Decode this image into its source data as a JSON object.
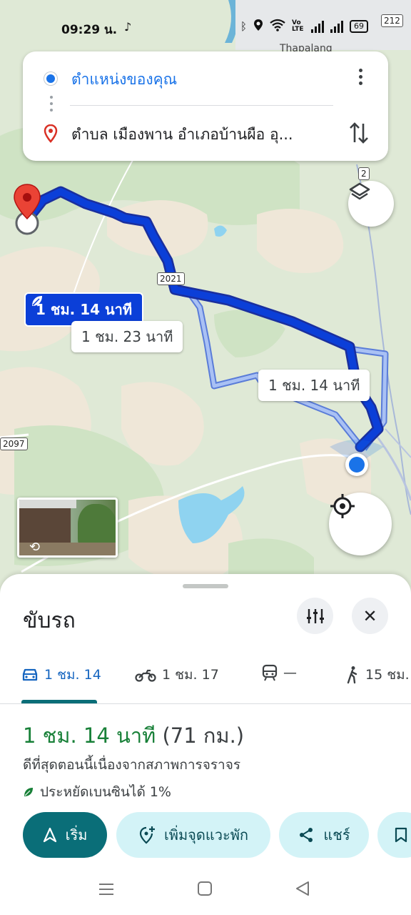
{
  "status_bar": {
    "time": "09:29 น.",
    "battery": "69",
    "volte": "Vo LTE",
    "shield_top": "212"
  },
  "search": {
    "origin": "ตำแหน่งของคุณ",
    "destination": "ตำบล เมืองพาน อำเภอบ้านผือ อุ..."
  },
  "map": {
    "place_label": "Thapalang",
    "road_2021": "2021",
    "road_2": "2",
    "road_2097": "2097",
    "route_main": "1 ชม. 14 นาที",
    "route_alt_1": "1 ชม. 23 นาที",
    "route_alt_2": "1 ชม. 14 นาที",
    "route_color": "#0b3fd8",
    "alt_route_color": "#8fb0ee"
  },
  "sheet": {
    "title": "ขับรถ",
    "tabs": [
      {
        "icon": "car-icon",
        "label": "1 ชม. 14"
      },
      {
        "icon": "motorcycle-icon",
        "label": "1 ชม. 17"
      },
      {
        "icon": "train-icon",
        "label": "—"
      },
      {
        "icon": "walk-icon",
        "label": "15 ชม."
      }
    ],
    "duration": "1 ชม. 14 นาที",
    "distance": "(71 กม.)",
    "description": "ดีที่สุดตอนนี้เนื่องจากสภาพการจราจร",
    "eco": "ประหยัดเบนซินได้ 1%",
    "actions": {
      "start": "เริ่ม",
      "add_stop": "เพิ่มจุดแวะพัก",
      "share": "แชร์"
    },
    "accent_color": "#0a6e78",
    "duration_color": "#188038"
  }
}
